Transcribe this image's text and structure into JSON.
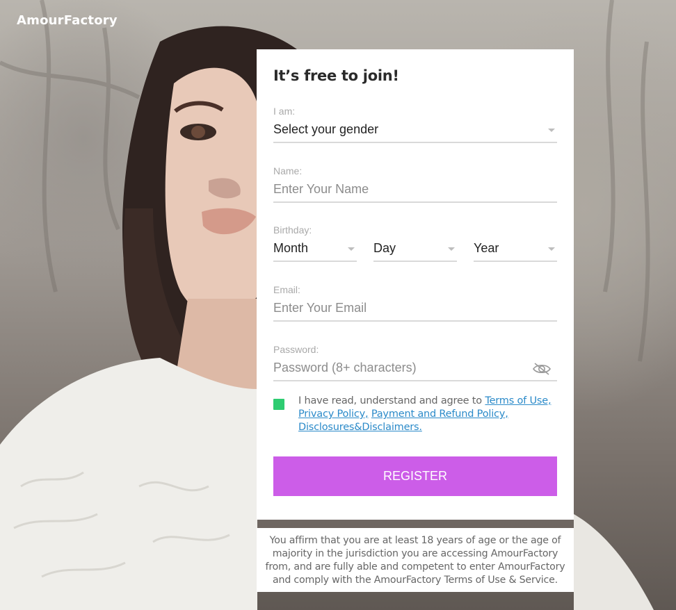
{
  "brand": {
    "logo_text": "AmourFactory"
  },
  "form": {
    "heading": "It’s free to join!",
    "gender": {
      "label": "I am:",
      "value": "Select your gender"
    },
    "name": {
      "label": "Name:",
      "placeholder": "Enter Your Name"
    },
    "birthday": {
      "label": "Birthday:",
      "month": "Month",
      "day": "Day",
      "year": "Year"
    },
    "email": {
      "label": "Email:",
      "placeholder": "Enter Your Email"
    },
    "password": {
      "label": "Password:",
      "placeholder": "Password (8+ characters)",
      "toggle_icon": "eye-slash-icon"
    },
    "agreement": {
      "checked": true,
      "checkbox_color": "#2ecc71",
      "text": "I have read, understand and agree to",
      "links": {
        "terms": "Terms of Use,",
        "privacy": "Privacy Policy,",
        "payment": "Payment and Refund Policy,",
        "disclosures": "Disclosures&Disclaimers."
      }
    },
    "register_label": "REGISTER",
    "register_color": "#cc5de8"
  },
  "disclaimer": "You affirm that you are at least 18 years of age or the age of majority in the jurisdiction you are accessing AmourFactory from, and are fully able and competent to enter AmourFactory and comply with the AmourFactory Terms of Use & Service."
}
